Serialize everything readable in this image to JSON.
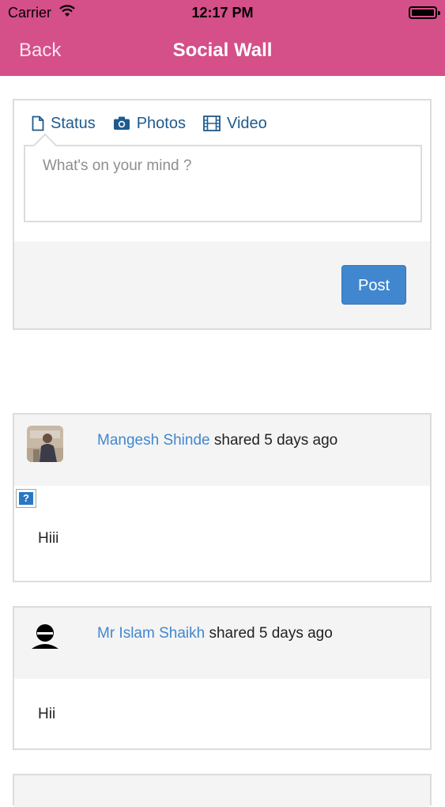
{
  "status_bar": {
    "carrier": "Carrier",
    "time": "12:17 PM"
  },
  "nav": {
    "back_label": "Back",
    "title": "Social Wall"
  },
  "composer": {
    "tabs": [
      {
        "label": "Status",
        "icon": "document-icon"
      },
      {
        "label": "Photos",
        "icon": "camera-icon"
      },
      {
        "label": "Video",
        "icon": "film-icon"
      }
    ],
    "placeholder": "What's on your mind ?",
    "post_label": "Post"
  },
  "feed": [
    {
      "author": "Mangesh Shinde",
      "action": " shared 5 days ago",
      "text": "Hiii",
      "has_broken_image": true
    },
    {
      "author": "Mr Islam Shaikh",
      "action": " shared 5 days ago",
      "text": "Hii",
      "has_broken_image": false
    }
  ],
  "colors": {
    "brand": "#d54f89",
    "link": "#4187cf",
    "tab_text": "#1f5a8e",
    "button": "#4187cf"
  }
}
